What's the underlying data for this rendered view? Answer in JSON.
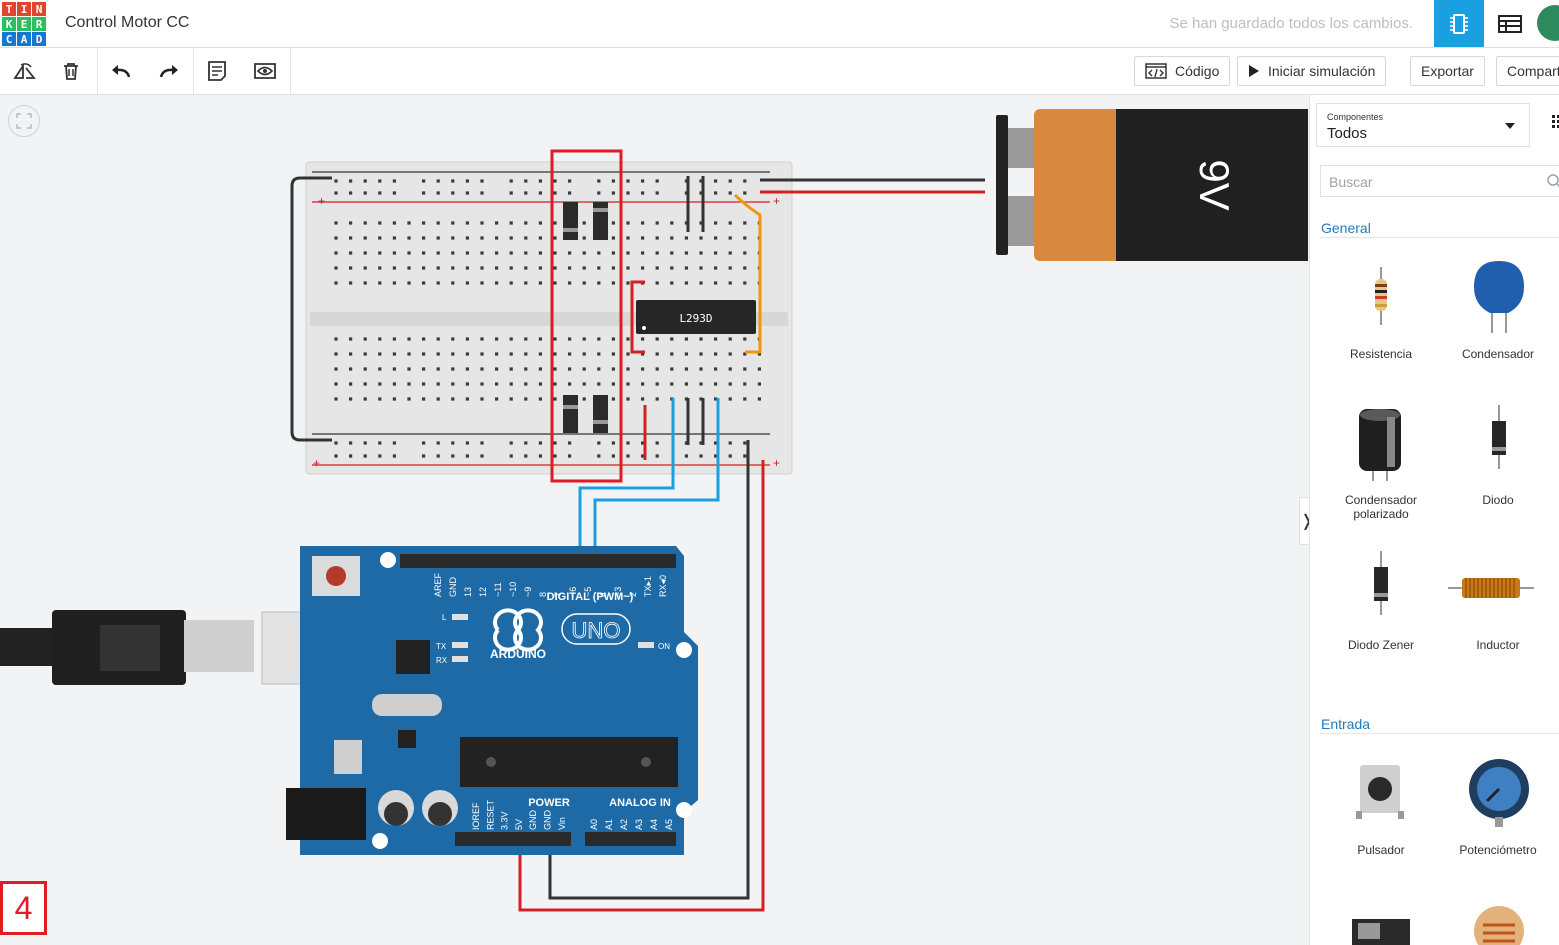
{
  "header": {
    "logo_letters": [
      "T",
      "I",
      "N",
      "K",
      "E",
      "R",
      "C",
      "A",
      "D"
    ],
    "logo_colors": [
      "#e2442f",
      "#e2442f",
      "#e2442f",
      "#2dbe60",
      "#2dbe60",
      "#2dbe60",
      "#1477d1",
      "#1477d1",
      "#1477d1"
    ],
    "title": "Control Motor CC",
    "status": "Se han guardado todos los cambios."
  },
  "toolbar": {
    "code_label": "Código",
    "simulate_label": "Iniciar simulación",
    "export_label": "Exportar",
    "share_label": "Compart"
  },
  "circuit": {
    "chip_label": "L293D",
    "battery_label": "9V",
    "board_name": "ARDUINO",
    "board_model": "UNO",
    "digital_label": "DIGITAL (PWM~)",
    "power_label": "POWER",
    "analog_label": "ANALOG IN",
    "on_label": "ON",
    "tx_label": "TX",
    "rx_label": "RX",
    "l_label": "L",
    "digital_pins": [
      "AREF",
      "GND",
      "13",
      "12",
      "~11",
      "~10",
      "~9",
      "8",
      "7",
      "~6",
      "~5",
      "4",
      "~3",
      "2",
      "TX▸1",
      "RX◂0"
    ],
    "power_pins": [
      "IOREF",
      "RESET",
      "3.3V",
      "5V",
      "GND",
      "GND",
      "Vin"
    ],
    "analog_pins": [
      "A0",
      "A1",
      "A2",
      "A3",
      "A4",
      "A5"
    ]
  },
  "panel": {
    "selector_label": "Componentes",
    "selector_value": "Todos",
    "search_placeholder": "Buscar",
    "section_general": "General",
    "section_input": "Entrada",
    "components": [
      {
        "label": "Resistencia"
      },
      {
        "label": "Condensador"
      },
      {
        "label": "Condensador polarizado"
      },
      {
        "label": "Diodo"
      },
      {
        "label": "Diodo Zener"
      },
      {
        "label": "Inductor"
      },
      {
        "label": "Pulsador"
      },
      {
        "label": "Potenciómetro"
      }
    ]
  },
  "page_number": "4",
  "colors": {
    "accent": "#1a9fe0",
    "highlight": "#e01b24"
  }
}
